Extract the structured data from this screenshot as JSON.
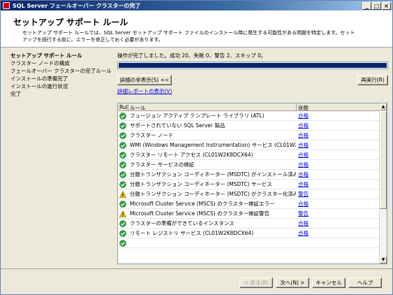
{
  "window": {
    "title": "SQL Server フェールオーバー クラスターの完了",
    "minimize_label": "_",
    "maximize_label": "□",
    "close_label": "×"
  },
  "header": {
    "title": "セットアップ サポート ルール",
    "description": "セットアップ サポート ルールでは、SQL Server セットアップ サポート ファイルのインストール時に発生する可能性がある問題を特定します。セットアップを続行する前に、エラーを修正しておく必要があります。"
  },
  "sidebar": {
    "items": [
      {
        "label": "セットアップ サポート ルール",
        "active": true
      },
      {
        "label": "クラスター ノードの構成",
        "active": false
      },
      {
        "label": "フェールオーバー クラスターの完了ルール",
        "active": false
      },
      {
        "label": "インストールの準備完了",
        "active": false
      },
      {
        "label": "インストールの進行状況",
        "active": false
      },
      {
        "label": "完了",
        "active": false
      }
    ]
  },
  "main": {
    "status_text": "操作が完了しました。成功 20、失敗 0、警告 2、スキップ 0。",
    "progress": 1.0,
    "details_button": "詳細の非表示(S) <<",
    "rerun_button": "再実行(R)",
    "report_link": "詳細レポートの表示(V)",
    "grid": {
      "headers": {
        "rul": "Rul",
        "rule": "ルール",
        "status": "状態"
      },
      "rows": [
        {
          "icon": "check-icon",
          "rule": "フュージョン アクティブ テンプレート ライブラリ (ATL)",
          "status": "合格"
        },
        {
          "icon": "check-icon",
          "rule": "サポートされていない SQL Server 製品",
          "status": "合格"
        },
        {
          "icon": "check-icon",
          "rule": "クラスター ノード",
          "status": "合格"
        },
        {
          "icon": "check-icon",
          "rule": "WMI (Windows Management Instrumentation) サービス (CL01W2K8...",
          "status": "合格"
        },
        {
          "icon": "check-icon",
          "rule": "クラスター リモート アクセス (CL01W2K8DCX64)",
          "status": "合格"
        },
        {
          "icon": "check-icon",
          "rule": "クラスター サービスの検証",
          "status": "合格"
        },
        {
          "icon": "check-icon",
          "rule": "分散トランザクション コーディネーター (MSDTC) がインストール済み (CL...",
          "status": "合格"
        },
        {
          "icon": "check-icon",
          "rule": "分散トランザクション コーディネーター (MSDTC) サービス",
          "status": "合格"
        },
        {
          "icon": "warning-icon",
          "rule": "分散トランザクション コーディネーター (MSDTC) がクラスター化済み",
          "status": "警告"
        },
        {
          "icon": "check-icon",
          "rule": "Microsoft Cluster Service (MSCS) のクラスター検証エラー",
          "status": "合格"
        },
        {
          "icon": "warning-icon",
          "rule": "Microsoft Cluster Service (MSCS) のクラスター検証警告",
          "status": "警告"
        },
        {
          "icon": "check-icon",
          "rule": "クラスターの準備ができているインスタンス",
          "status": "合格"
        },
        {
          "icon": "check-icon",
          "rule": "リモート レジストリ サービス (CL01W2K8DCX64)",
          "status": "合格"
        },
        {
          "icon": "check-icon",
          "rule": "",
          "status": ""
        }
      ]
    }
  },
  "footer": {
    "back_button": "< 戻る(B)",
    "next_button": "次へ(N) >",
    "cancel_button": "キャンセル",
    "help_button": "ヘルプ"
  },
  "colors": {
    "pass": "#2ea043",
    "warning": "#f2c300",
    "link": "#0000ee",
    "progress": "#0a246a"
  }
}
